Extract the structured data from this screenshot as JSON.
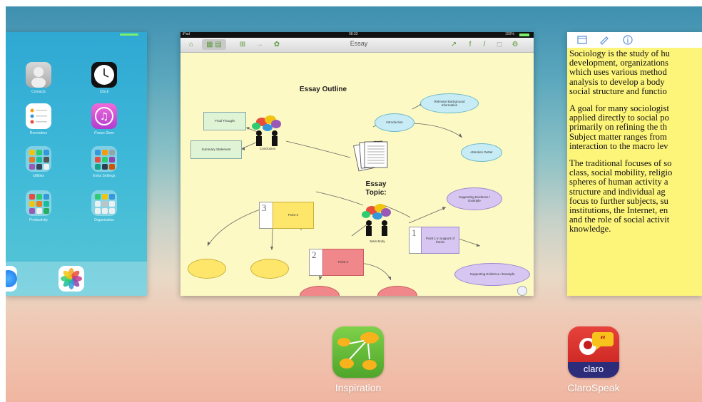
{
  "home": {
    "apps": [
      {
        "label": "Contacts",
        "icon": "contacts-icon"
      },
      {
        "label": "Clock",
        "icon": "clock-icon"
      },
      {
        "label": "Reminders",
        "icon": "reminders-icon"
      },
      {
        "label": "iTunes Store",
        "icon": "itunes-icon"
      },
      {
        "label": "Utilities",
        "icon": "folder-icon"
      },
      {
        "label": "Extra Settings",
        "icon": "folder-icon"
      },
      {
        "label": "Productivity",
        "icon": "folder-icon"
      },
      {
        "label": "Organisation",
        "icon": "folder-icon"
      }
    ],
    "dock": [
      {
        "label": "Safari",
        "icon": "safari-icon"
      },
      {
        "label": "Photos",
        "icon": "photos-icon"
      }
    ]
  },
  "inspiration": {
    "status": {
      "device": "iPad",
      "time": "08:33",
      "battery": "100%"
    },
    "toolbar_title": "Essay",
    "heading": "Essay Outline",
    "topic": "Essay Topic:",
    "nodes": {
      "final_thought": "Final Thought",
      "summary": "Summary Statement",
      "conclusion": "Conclusion",
      "introduction": "Introduction",
      "background": "Relevant Background Information",
      "attention": "Attention Getter",
      "evidence1": "Supporting Evidence / Example",
      "evidence2": "Supporting Evidence / Example",
      "point1": "Point 1 in support of thesis",
      "point2": "Point 2",
      "point3": "Point 3",
      "main_body": "Main Body",
      "num1": "1",
      "num2": "2",
      "num3": "3"
    }
  },
  "claro": {
    "paragraphs": [
      [
        "Sociology is the study of hu",
        "development, organizations",
        "which uses various method",
        "analysis to develop a body",
        "social structure and functio"
      ],
      [
        "A goal for many sociologist",
        "applied directly to social po",
        "primarily on refining the th",
        "Subject matter ranges from",
        "interaction to the macro lev"
      ],
      [
        "The traditional focuses of so",
        "class, social mobility, religio",
        "spheres of human activity a",
        "structure and individual ag",
        "focus to further subjects, su",
        "institutions, the Internet, en",
        "and the role of social activit",
        "knowledge."
      ]
    ]
  },
  "bottom_apps": [
    {
      "label": "Inspiration",
      "icon": "inspiration-app-icon"
    },
    {
      "label": "ClaroSpeak",
      "icon": "clarospeak-app-icon",
      "badge": "claro"
    }
  ],
  "colors": {
    "inspiration_green": "#6cbf35",
    "claro_red": "#d9302b",
    "text_highlight": "#fdf47a"
  }
}
